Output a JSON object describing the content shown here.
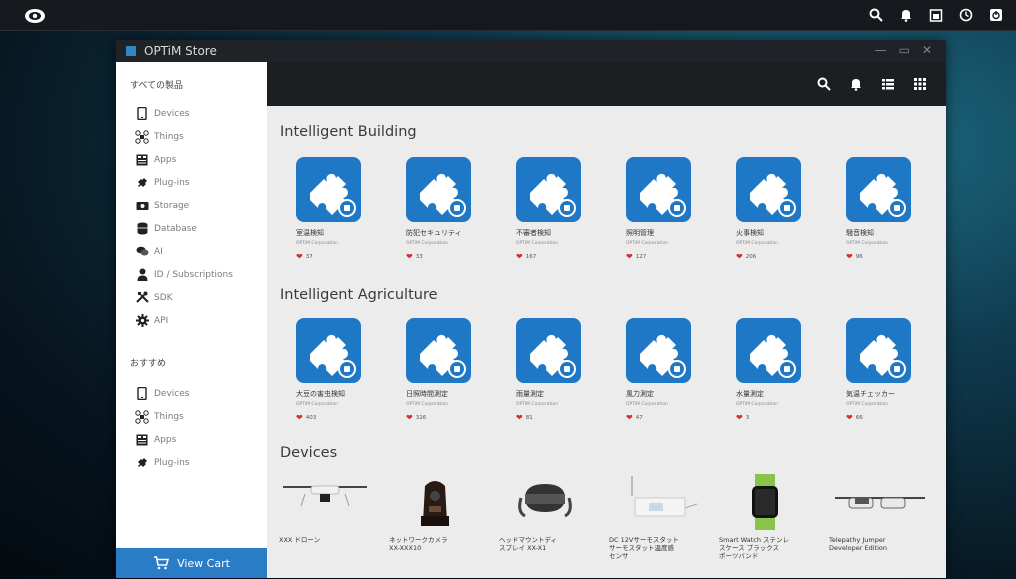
{
  "window": {
    "title": "OPTiM Store"
  },
  "sidebar": {
    "section1_title": "すべての製品",
    "section1": [
      {
        "label": "Devices",
        "icon": "phone-icon"
      },
      {
        "label": "Things",
        "icon": "drone-icon"
      },
      {
        "label": "Apps",
        "icon": "apps-icon"
      },
      {
        "label": "Plug-ins",
        "icon": "plugin-icon"
      },
      {
        "label": "Storage",
        "icon": "storage-icon"
      },
      {
        "label": "Database",
        "icon": "database-icon"
      },
      {
        "label": "AI",
        "icon": "chat-icon"
      },
      {
        "label": "ID / Subscriptions",
        "icon": "person-icon"
      },
      {
        "label": "SDK",
        "icon": "tools-icon"
      },
      {
        "label": "API",
        "icon": "gear-icon"
      }
    ],
    "section2_title": "おすすめ",
    "section2": [
      {
        "label": "Devices",
        "icon": "phone-icon"
      },
      {
        "label": "Things",
        "icon": "drone-icon"
      },
      {
        "label": "Apps",
        "icon": "apps-icon"
      },
      {
        "label": "Plug-ins",
        "icon": "plugin-icon"
      }
    ],
    "view_cart": "View Cart"
  },
  "categories": [
    {
      "title": "Intelligent Building",
      "items": [
        {
          "name": "室温検知",
          "corp": "OPTiM Corporation",
          "likes": "37",
          "badge": "wifi"
        },
        {
          "name": "防犯セキュリティ",
          "corp": "OPTiM Corporation",
          "likes": "33",
          "badge": "camera"
        },
        {
          "name": "不審者検知",
          "corp": "OPTiM Corporation",
          "likes": "167",
          "badge": "walk"
        },
        {
          "name": "照明管理",
          "corp": "OPTiM Corporation",
          "likes": "127",
          "badge": "bulb"
        },
        {
          "name": "火事検知",
          "corp": "OPTiM Corporation",
          "likes": "206",
          "badge": "fire"
        },
        {
          "name": "騒音検知",
          "corp": "OPTiM Corporation",
          "likes": "96",
          "badge": "mic"
        }
      ]
    },
    {
      "title": "Intelligent Agriculture",
      "items": [
        {
          "name": "大豆の害虫検知",
          "corp": "OPTiM Corporation",
          "likes": "403",
          "badge": "camera"
        },
        {
          "name": "日照時間測定",
          "corp": "OPTiM Corporation",
          "likes": "326",
          "badge": "sun"
        },
        {
          "name": "雨量測定",
          "corp": "OPTiM Corporation",
          "likes": "81",
          "badge": "cloud"
        },
        {
          "name": "風力測定",
          "corp": "OPTiM Corporation",
          "likes": "47",
          "badge": "wind"
        },
        {
          "name": "水量測定",
          "corp": "OPTiM Corporation",
          "likes": "3",
          "badge": "water"
        },
        {
          "name": "気温チェッカー",
          "corp": "OPTiM Corporation",
          "likes": "66",
          "badge": "thermo"
        }
      ]
    }
  ],
  "devices": {
    "title": "Devices",
    "items": [
      {
        "name": "XXX ドローン",
        "icon": "drone-image"
      },
      {
        "name": "ネットワークカメラ\nXX-XXX10",
        "icon": "camera-image"
      },
      {
        "name": "ヘッドマウントディ\nスプレイ XX-X1",
        "icon": "vr-headset-image"
      },
      {
        "name": "DC 12Vサーモスタット\nサーモスタット温度感\nセンサ",
        "icon": "thermostat-image"
      },
      {
        "name": "Smart Watch ステンレ\nスケース ブラックス\nポーツバンド",
        "icon": "smartwatch-image"
      },
      {
        "name": "Telepathy Jumper\nDeveloper Edition",
        "icon": "smartglasses-image"
      }
    ]
  },
  "colors": {
    "accent": "#1e78c6",
    "cart": "#2a7cc7",
    "heart": "#d32f2f",
    "toolbar": "#1c1f22"
  }
}
